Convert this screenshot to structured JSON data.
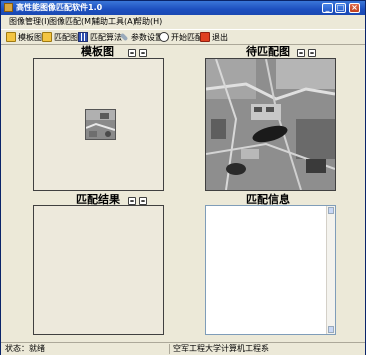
{
  "window": {
    "title": "高性能图像匹配软件1.0"
  },
  "menubar": {
    "items": [
      {
        "label": "图像管理(I)"
      },
      {
        "label": "图像匹配(M)"
      },
      {
        "label": "辅助工具(A)"
      },
      {
        "label": "帮助(H)"
      }
    ]
  },
  "toolbar": {
    "template_label": "模板图",
    "match_img_label": "匹配图",
    "algorithm_label": "匹配算法",
    "params_label": "参数设置",
    "start_label": "开始匹配",
    "exit_label": "退出"
  },
  "panels": {
    "template_title": "模板图",
    "target_title": "待匹配图",
    "result_title": "匹配结果",
    "info_title": "匹配信息"
  },
  "statusbar": {
    "status": "状态：就绪",
    "org": "空军工程大学计算机工程系"
  },
  "colors": {
    "panel_bg": "#ece9d8",
    "titlebar": "#1d4fbf"
  }
}
